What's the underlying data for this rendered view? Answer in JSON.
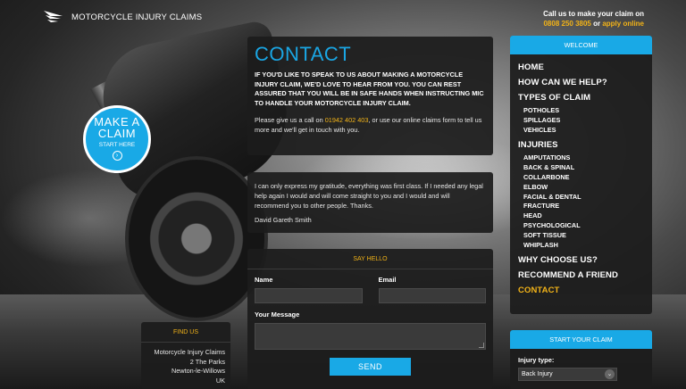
{
  "header": {
    "logo_text": "MOTORCYCLE INJURY CLAIMS",
    "call_line": "Call us to make your claim on",
    "phone": "0808 250 3805",
    "or_text": " or ",
    "apply_link": "apply online"
  },
  "claim_circle": {
    "line1": "MAKE A",
    "line2": "CLAIM",
    "line3": "START HERE"
  },
  "contact": {
    "title": "CONTACT",
    "lead": "If you'd like to speak to us about making a motorcycle injury claim, we'd love to hear from you. You can rest assured that you will be in safe hands when instructing MIC to handle your motorcycle injury claim.",
    "body_pre": "Please give us a call on ",
    "phone": "01942 402 403",
    "body_post": ", or use our online claims form to tell us more and we'll get in touch with you."
  },
  "testimonial": {
    "quote": "I can only express my gratitude, everything was first class. If I needed any legal help again I would and will come straight to you and I would and will recommend you to other people. Thanks.",
    "author": "David Gareth Smith"
  },
  "say_hello": {
    "heading": "SAY HELLO",
    "name_label": "Name",
    "email_label": "Email",
    "message_label": "Your Message",
    "send_label": "SEND"
  },
  "find_us": {
    "heading": "FIND US",
    "address": [
      "Motorcycle Injury Claims",
      "2 The Parks",
      "Newton-le-Willows",
      "UK"
    ]
  },
  "sidebar": {
    "heading": "WELCOME",
    "home": "HOME",
    "help": "HOW CAN WE HELP?",
    "types": "TYPES OF CLAIM",
    "types_items": [
      "POTHOLES",
      "SPILLAGES",
      "VEHICLES"
    ],
    "injuries": "INJURIES",
    "injury_items": [
      "AMPUTATIONS",
      "BACK & SPINAL",
      "COLLARBONE",
      "ELBOW",
      "FACIAL & DENTAL",
      "FRACTURE",
      "HEAD",
      "PSYCHOLOGICAL",
      "SOFT TISSUE",
      "WHIPLASH"
    ],
    "why": "WHY CHOOSE US?",
    "recommend": "RECOMMEND A FRIEND",
    "contact": "CONTACT"
  },
  "start_claim": {
    "heading": "START YOUR CLAIM",
    "injury_type_label": "Injury type:",
    "injury_type_value": "Back Injury"
  },
  "colors": {
    "accent_blue": "#19a9e6",
    "accent_yellow": "#f2b318",
    "panel_bg": "#1c1c1c"
  }
}
